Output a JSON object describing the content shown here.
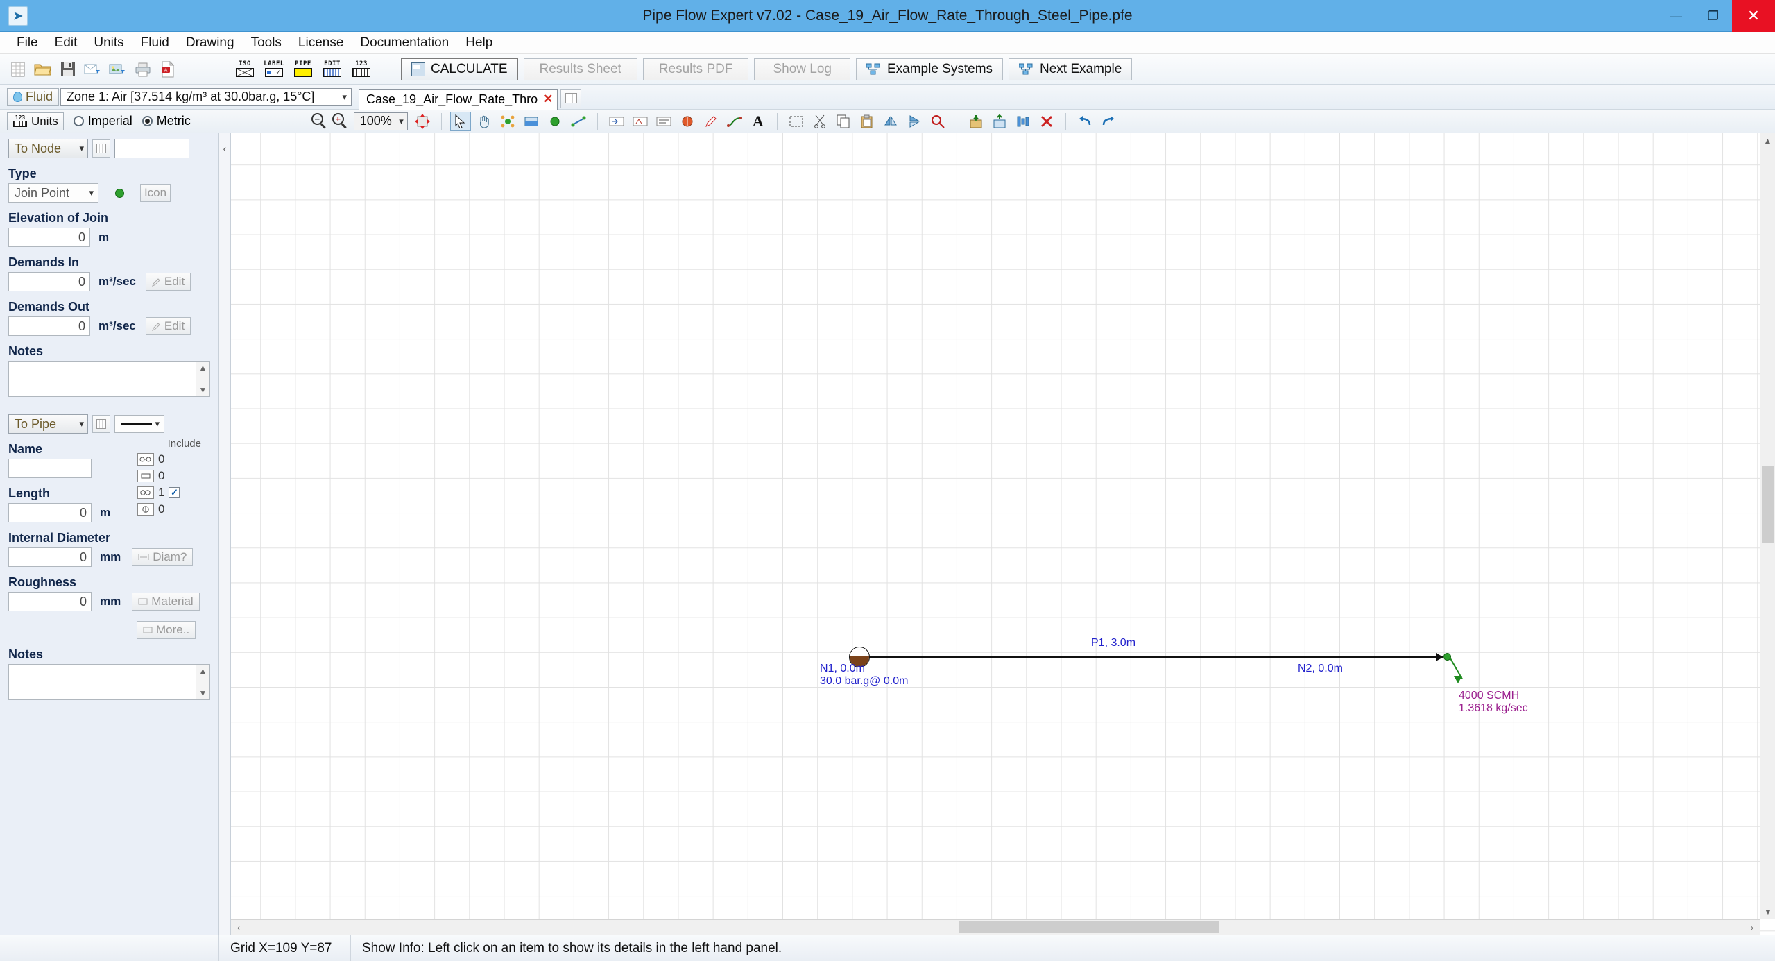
{
  "window": {
    "title": "Pipe Flow Expert v7.02 - Case_19_Air_Flow_Rate_Through_Steel_Pipe.pfe",
    "minimize": "—",
    "maximize": "❐",
    "close": "✕",
    "app_icon": "➤"
  },
  "menu": {
    "items": [
      {
        "label": "File"
      },
      {
        "label": "Edit"
      },
      {
        "label": "Units"
      },
      {
        "label": "Fluid"
      },
      {
        "label": "Drawing"
      },
      {
        "label": "Tools"
      },
      {
        "label": "License"
      },
      {
        "label": "Documentation"
      },
      {
        "label": "Help"
      }
    ]
  },
  "toolbar": {
    "label_icons": [
      {
        "name": "iso-icon",
        "caption": "ISO"
      },
      {
        "name": "label-icon",
        "caption": "LABEL"
      },
      {
        "name": "pipe-icon",
        "caption": "PIPE"
      },
      {
        "name": "edit-icon",
        "caption": "EDIT"
      },
      {
        "name": "units123-icon",
        "caption": "123"
      }
    ],
    "calculate": "CALCULATE",
    "results_sheet": "Results Sheet",
    "results_pdf": "Results PDF",
    "show_log": "Show Log",
    "example_systems": "Example Systems",
    "next_example": "Next Example"
  },
  "fluid_bar": {
    "fluid_button": "Fluid",
    "zone_value": "Zone 1: Air [37.514 kg/m³ at 30.0bar.g, 15°C]",
    "tab_label": "Case_19_Air_Flow_Rate_Thro",
    "tab_close": "✕"
  },
  "units_bar": {
    "units_button": "Units",
    "units_caption": "123",
    "imperial": "Imperial",
    "metric": "Metric",
    "selected_unit_system": "Metric",
    "zoom_out": "−",
    "zoom_in": "+",
    "zoom_value": "100%"
  },
  "node_panel": {
    "selector": "To Node",
    "type_label": "Type",
    "type_value": "Join Point",
    "icon_button": "Icon",
    "elevation_label": "Elevation of Join",
    "elevation_value": "0",
    "elevation_unit": "m",
    "demands_in_label": "Demands In",
    "demands_in_value": "0",
    "demands_in_unit": "m³/sec",
    "demands_in_edit": "Edit",
    "demands_out_label": "Demands Out",
    "demands_out_value": "0",
    "demands_out_unit": "m³/sec",
    "demands_out_edit": "Edit",
    "notes_label": "Notes",
    "notes_value": ""
  },
  "pipe_panel": {
    "selector": "To Pipe",
    "include_label": "Include",
    "name_label": "Name",
    "name_value": "",
    "length_label": "Length",
    "length_value": "0",
    "length_unit": "m",
    "counters": [
      {
        "name": "fittings-count",
        "value": "0"
      },
      {
        "name": "valves-count",
        "value": "0"
      },
      {
        "name": "components-count",
        "value": "1"
      },
      {
        "name": "pumps-count",
        "value": "0"
      }
    ],
    "include_checked": true,
    "diameter_label": "Internal Diameter",
    "diameter_value": "0",
    "diameter_unit": "mm",
    "diameter_button": "Diam?",
    "roughness_label": "Roughness",
    "roughness_value": "0",
    "roughness_unit": "mm",
    "material_button": "Material",
    "more_button": "More..",
    "notes_label": "Notes",
    "notes_value": ""
  },
  "diagram": {
    "node1_label": "N1, 0.0m",
    "node1_pressure": "30.0 bar.g@ 0.0m",
    "pipe_label": "P1, 3.0m",
    "node2_label": "N2, 0.0m",
    "flow_scmh": "4000 SCMH",
    "flow_mass": "1.3618 kg/sec"
  },
  "statusbar": {
    "grid_coords": "Grid  X=109  Y=87",
    "show_info": "Show Info: Left click on an item to show its details in the left hand panel."
  },
  "scroll": {
    "left_arrow": "‹",
    "right_arrow": "›",
    "up_arrow": "▲",
    "down_arrow": "▼",
    "collapse": "‹"
  }
}
